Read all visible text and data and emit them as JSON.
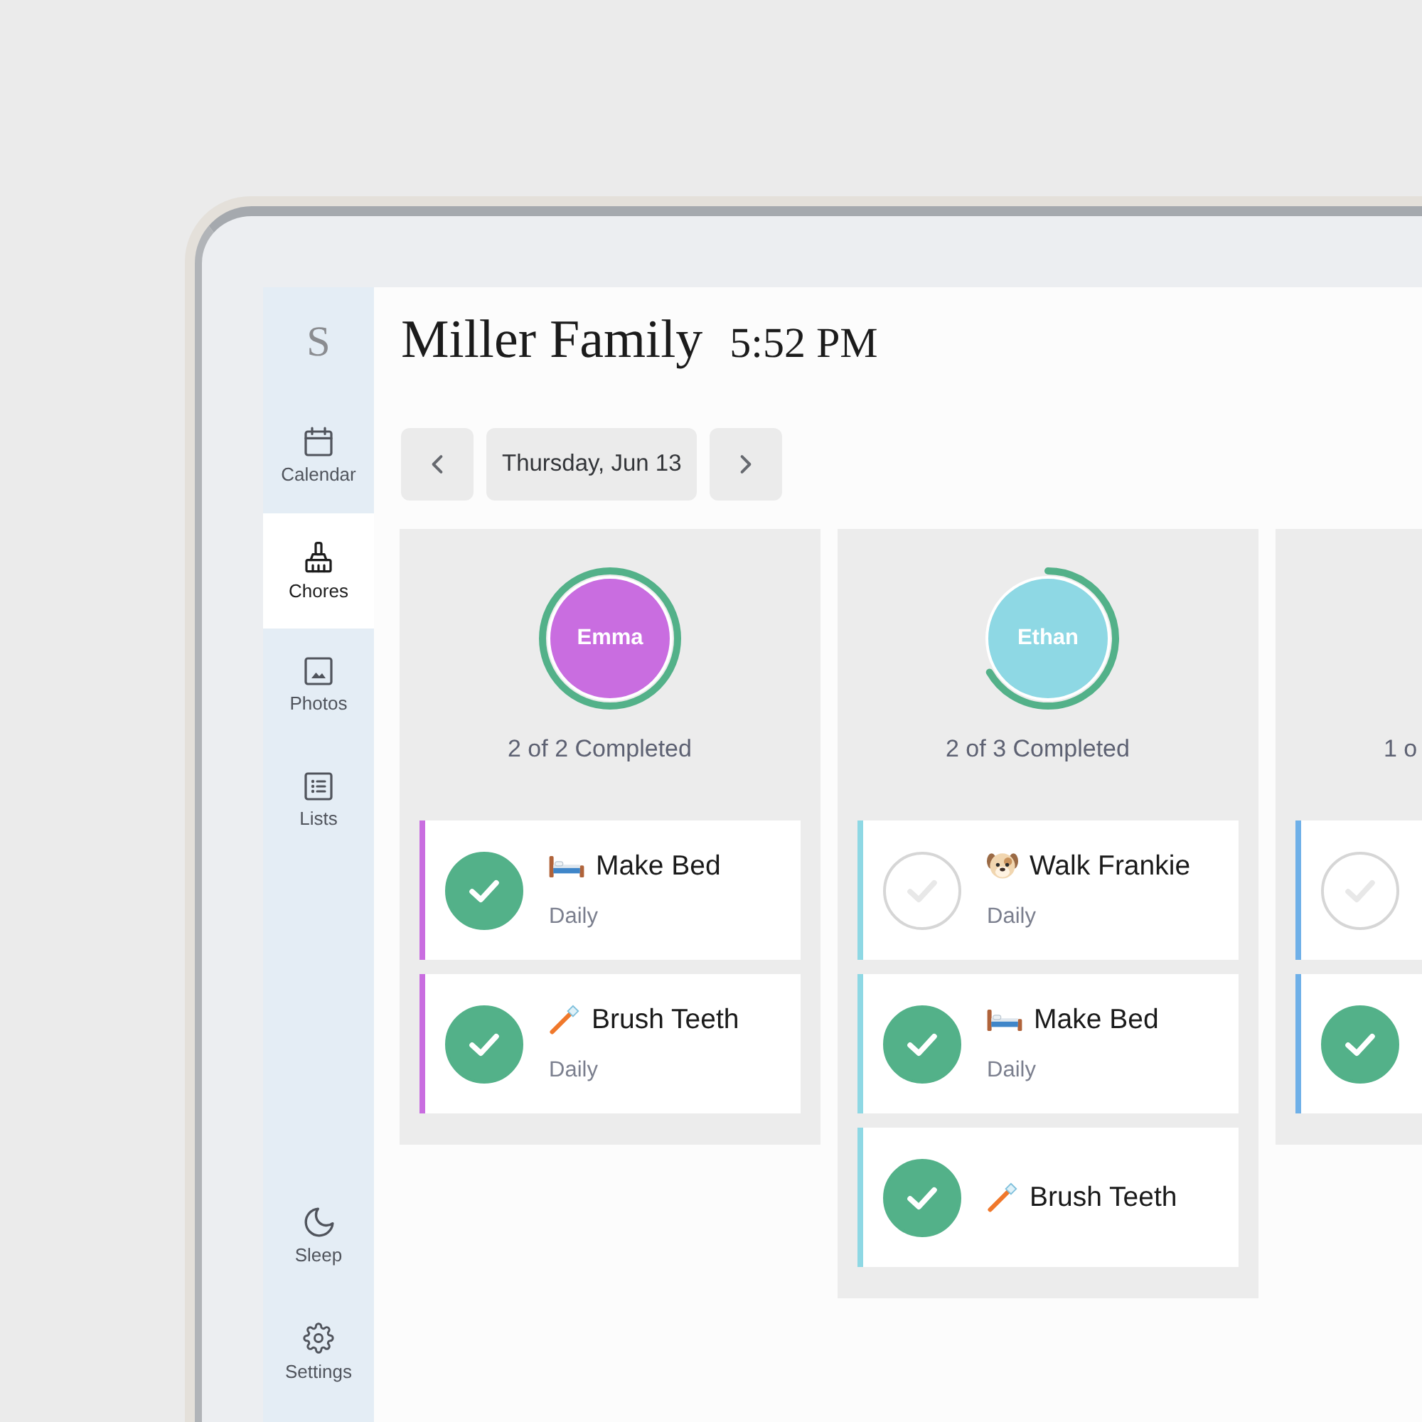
{
  "sidebar": {
    "logo": "S",
    "items": [
      {
        "kind": "calendar",
        "label": "Calendar",
        "selected": false
      },
      {
        "kind": "chores",
        "label": "Chores",
        "selected": true
      },
      {
        "kind": "photos",
        "label": "Photos",
        "selected": false
      },
      {
        "kind": "lists",
        "label": "Lists",
        "selected": false
      }
    ],
    "footer_items": [
      {
        "kind": "sleep",
        "label": "Sleep",
        "selected": false
      },
      {
        "kind": "settings",
        "label": "Settings",
        "selected": false
      }
    ]
  },
  "header": {
    "title": "Miller Family",
    "time": "5:52 PM"
  },
  "date_nav": {
    "date": "Thursday, Jun 13"
  },
  "members": [
    {
      "name": "Emma",
      "color": "#c96de0",
      "summary": "2 of 2 Completed",
      "tasks": [
        {
          "kind": "bed",
          "title": "Make Bed",
          "repeat": "Daily",
          "checked": true
        },
        {
          "kind": "toothbrush",
          "title": "Brush Teeth",
          "repeat": "Daily",
          "checked": true
        }
      ]
    },
    {
      "name": "Ethan",
      "color": "#8ed8e4",
      "summary": "2 of 3 Completed",
      "tasks": [
        {
          "kind": "dog",
          "title": "Walk Frankie",
          "repeat": "Daily",
          "checked": false
        },
        {
          "kind": "bed",
          "title": "Make Bed",
          "repeat": "Daily",
          "checked": true
        },
        {
          "kind": "toothbrush",
          "title": "Brush Teeth",
          "checked": true
        }
      ]
    },
    {
      "color": "#6fb0e8",
      "summary": "1 o",
      "tasks": [
        {
          "checked": false
        },
        {
          "checked": true
        }
      ]
    }
  ]
}
